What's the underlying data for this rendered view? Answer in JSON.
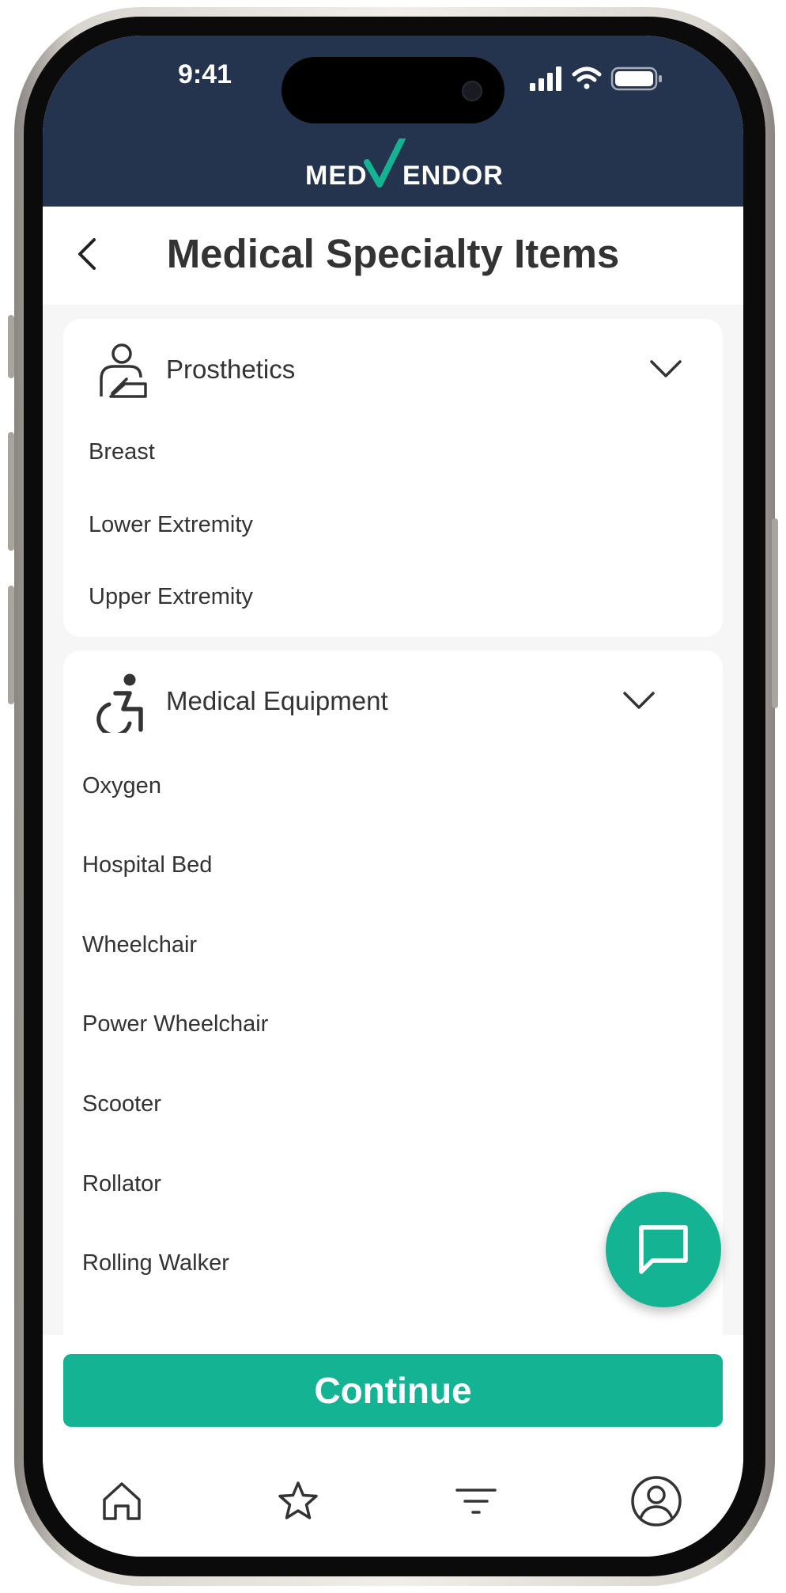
{
  "status_bar": {
    "time": "9:41"
  },
  "brand": {
    "logo_text_left": "MED",
    "logo_text_right": "ENDOR"
  },
  "header": {
    "title": "Medical Specialty Items"
  },
  "categories": [
    {
      "label": "Prosthetics",
      "icon": "person-arm-sling-icon",
      "items": [
        "Breast",
        "Lower Extremity",
        "Upper Extremity"
      ]
    },
    {
      "label": "Medical Equipment",
      "icon": "wheelchair-icon",
      "items": [
        "Oxygen",
        "Hospital Bed",
        "Wheelchair",
        "Power Wheelchair",
        "Scooter",
        "Rollator",
        "Rolling Walker"
      ]
    }
  ],
  "actions": {
    "continue_label": "Continue",
    "chat_icon": "chat-bubble-icon"
  },
  "bottom_nav": [
    {
      "icon": "home-icon"
    },
    {
      "icon": "star-icon"
    },
    {
      "icon": "filter-icon"
    },
    {
      "icon": "profile-icon"
    }
  ],
  "colors": {
    "header_bg": "#24344f",
    "accent": "#13b394",
    "content_bg": "#f6f6f6",
    "text": "#333333"
  }
}
